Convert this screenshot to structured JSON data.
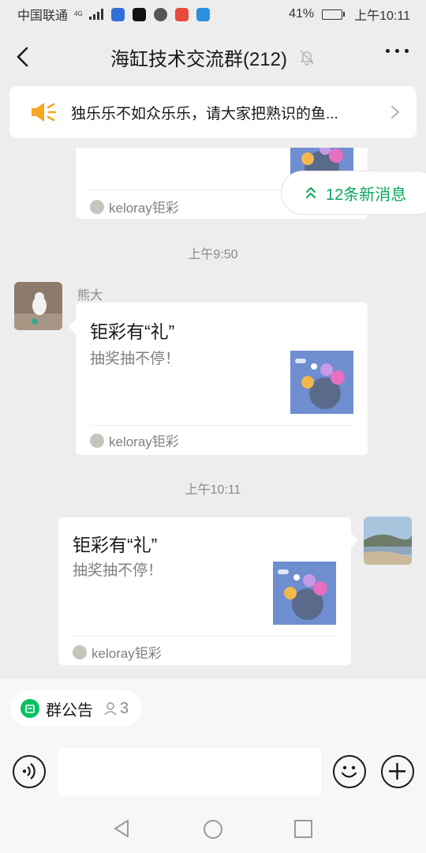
{
  "status_bar": {
    "carrier": "中国联通",
    "network": "4G",
    "battery": "41%",
    "battery_level": 0.41,
    "time": "上午10:11"
  },
  "header": {
    "title": "海缸技术交流群(212)",
    "back_icon": "chevron-left-icon",
    "mute_icon": "bell-muted-icon",
    "more_icon": "more-dots-icon"
  },
  "notice": {
    "icon": "megaphone-icon",
    "text": "独乐乐不如众乐乐，请大家把熟识的鱼..."
  },
  "new_messages": {
    "label": "12条新消息",
    "icon": "double-chevron-up-icon"
  },
  "messages": [
    {
      "type": "share-card-partial",
      "source": "keloray钜彩"
    },
    {
      "type": "time",
      "text": "上午9:50"
    },
    {
      "type": "share-card",
      "direction": "incoming",
      "sender": "熊大",
      "title": "钜彩有“礼”",
      "desc": "抽奖抽不停！",
      "source": "keloray钜彩"
    },
    {
      "type": "time",
      "text": "上午10:11"
    },
    {
      "type": "share-card",
      "direction": "outgoing",
      "title": "钜彩有“礼”",
      "desc": "抽奖抽不停！",
      "source": "keloray钜彩"
    }
  ],
  "bottom": {
    "announcement_label": "群公告",
    "announcement_count": "3",
    "voice_icon": "voice-icon",
    "emoji_icon": "emoji-icon",
    "plus_icon": "plus-icon"
  },
  "colors": {
    "accent_green": "#07c160",
    "new_msg_green": "#07a75b",
    "background": "#ededed"
  }
}
